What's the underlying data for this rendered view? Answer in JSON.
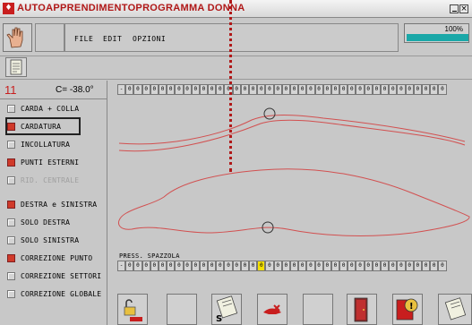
{
  "window": {
    "title": "AUTOAPPRENDIMENTOPROGRAMMA DONNA",
    "minimize_label": "",
    "close_label": "×"
  },
  "menu": {
    "file": "FILE",
    "edit": "EDIT",
    "options": "OPZIONI"
  },
  "progress": {
    "label": "100%",
    "value": 1.0
  },
  "header": {
    "number": "11",
    "c_value": "C= -38.0°"
  },
  "options": [
    {
      "label": "CARDA + COLLA",
      "checked": false,
      "enabled": true,
      "selected": false
    },
    {
      "label": "CARDATURA",
      "checked": true,
      "enabled": true,
      "selected": true
    },
    {
      "label": "INCOLLATURA",
      "checked": false,
      "enabled": true,
      "selected": false
    },
    {
      "label": "PUNTI ESTERNI",
      "checked": true,
      "enabled": true,
      "selected": false
    },
    {
      "label": "RID. CENTRALE",
      "checked": false,
      "enabled": false,
      "selected": false
    },
    {
      "label": "DESTRA e SINISTRA",
      "checked": true,
      "enabled": true,
      "selected": false
    },
    {
      "label": "SOLO DESTRA",
      "checked": false,
      "enabled": true,
      "selected": false
    },
    {
      "label": "SOLO SINISTRA",
      "checked": false,
      "enabled": true,
      "selected": false
    },
    {
      "label": "CORREZIONE PUNTO",
      "checked": true,
      "enabled": true,
      "selected": false
    },
    {
      "label": "CORREZIONE SETTORI",
      "checked": false,
      "enabled": true,
      "selected": false
    },
    {
      "label": "CORREZIONE GLOBALE",
      "checked": false,
      "enabled": true,
      "selected": false
    }
  ],
  "strip_top": {
    "first": "-",
    "cell": "0",
    "count": 40
  },
  "strip_bottom": {
    "label": "PRESS. SPAZZOLA",
    "first": "-",
    "cell": "0",
    "count": 40,
    "highlight_index": 17
  },
  "bottom_toolbar": [
    {
      "icon": "unlock-red-icon"
    },
    {
      "icon": "blank-icon"
    },
    {
      "icon": "save-document-icon",
      "label": "S"
    },
    {
      "icon": "delete-red-icon"
    },
    {
      "icon": "blank-icon"
    },
    {
      "icon": "exit-door-icon"
    },
    {
      "icon": "info-red-icon"
    },
    {
      "icon": "edit-document-icon"
    }
  ],
  "colors": {
    "accent": "#c81e1e",
    "progress": "#1aa8a8",
    "highlight": "#f4e000",
    "outline": "#d25050"
  }
}
